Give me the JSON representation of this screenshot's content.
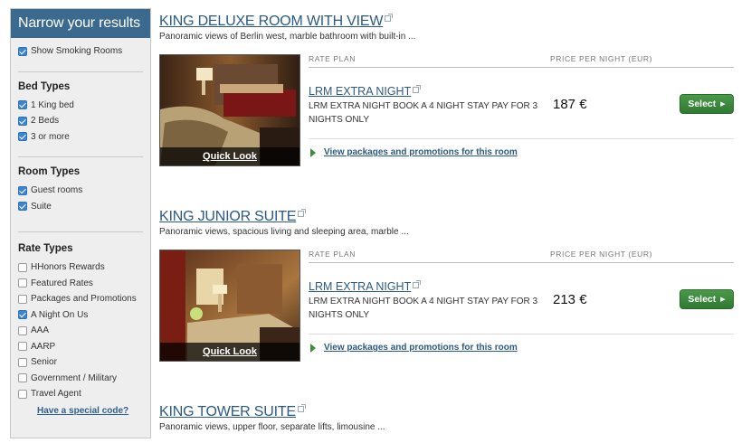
{
  "sidebar": {
    "header": "Narrow your results",
    "smoking": {
      "label": "Show Smoking Rooms",
      "checked": true
    },
    "bed_types": {
      "title": "Bed Types",
      "items": [
        {
          "label": "1 King bed",
          "checked": true
        },
        {
          "label": "2 Beds",
          "checked": true
        },
        {
          "label": "3 or more",
          "checked": true
        }
      ]
    },
    "room_types": {
      "title": "Room Types",
      "items": [
        {
          "label": "Guest rooms",
          "checked": true
        },
        {
          "label": "Suite",
          "checked": true
        }
      ]
    },
    "rate_types": {
      "title": "Rate Types",
      "items": [
        {
          "label": "HHonors Rewards",
          "checked": false
        },
        {
          "label": "Featured Rates",
          "checked": false
        },
        {
          "label": "Packages and Promotions",
          "checked": false
        },
        {
          "label": "A Night On Us",
          "checked": true
        },
        {
          "label": "AAA",
          "checked": false
        },
        {
          "label": "AARP",
          "checked": false
        },
        {
          "label": "Senior",
          "checked": false
        },
        {
          "label": "Government / Military",
          "checked": false
        },
        {
          "label": "Travel Agent",
          "checked": false
        }
      ]
    },
    "special_code": "Have a special code?"
  },
  "rooms": [
    {
      "title": "KING DELUXE ROOM WITH VIEW",
      "desc": "Panoramic views of Berlin west, marble bathroom with built-in ...",
      "quick_look": "Quick Look",
      "rate_plan_head": "RATE PLAN",
      "price_head": "PRICE PER NIGHT (EUR)",
      "plan_name": "LRM EXTRA NIGHT",
      "plan_desc": "LRM EXTRA NIGHT BOOK A 4 NIGHT STAY PAY FOR 3 NIGHTS ONLY",
      "price": "187 €",
      "select": "Select",
      "packages": "View packages and promotions for this room"
    },
    {
      "title": "KING JUNIOR SUITE",
      "desc": "Panoramic views, spacious living and sleeping area, marble ...",
      "quick_look": "Quick Look",
      "rate_plan_head": "RATE PLAN",
      "price_head": "PRICE PER NIGHT (EUR)",
      "plan_name": "LRM EXTRA NIGHT",
      "plan_desc": "LRM EXTRA NIGHT BOOK A 4 NIGHT STAY PAY FOR 3 NIGHTS ONLY",
      "price": "213 €",
      "select": "Select",
      "packages": "View packages and promotions for this room"
    },
    {
      "title": "KING TOWER SUITE",
      "desc": "Panoramic views, upper floor, separate lifts, limousine ..."
    }
  ],
  "colors": {
    "header_bg": "#3b6a8e",
    "link": "#2b5a87",
    "select_green": "#2f7a32",
    "checkbox_checked": "#3d86d6"
  }
}
